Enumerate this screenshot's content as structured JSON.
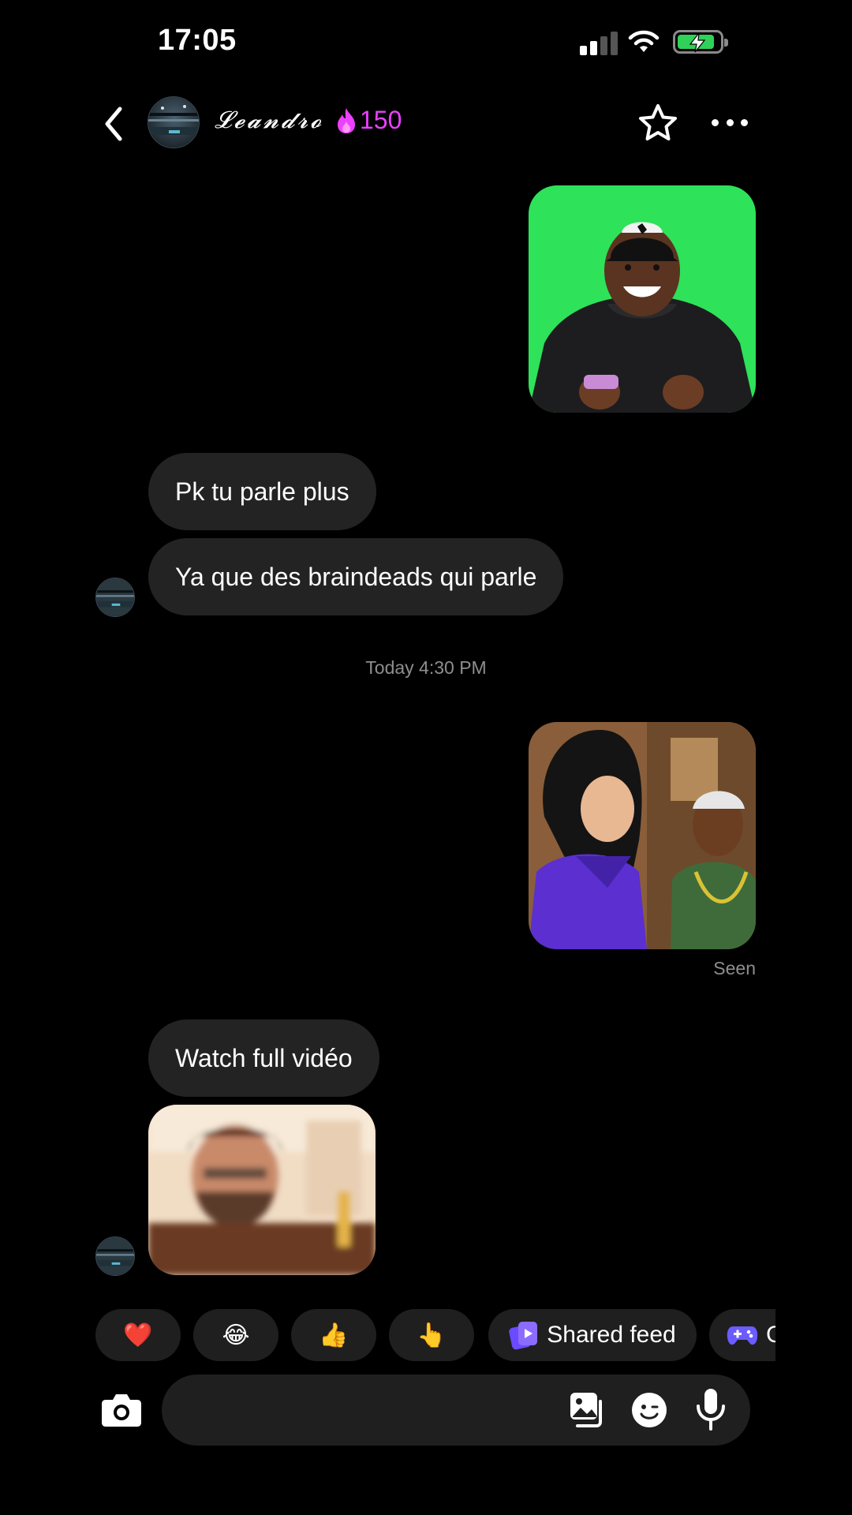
{
  "status_bar": {
    "time": "17:05",
    "signal_icon": "cellular-signal-icon",
    "wifi_icon": "wifi-icon",
    "battery_icon": "battery-charging-icon",
    "battery_color": "#30d158"
  },
  "header": {
    "back_icon": "chevron-left-icon",
    "contact_name": "𝓛𝓮𝓪𝓷𝓭𝓻𝓸",
    "streak_icon": "flame-icon",
    "streak_count": "150",
    "streak_color": "#ec40ff",
    "favorite_icon": "star-outline-icon",
    "more_icon": "more-horizontal-icon"
  },
  "messages": [
    {
      "type": "media",
      "from": "me",
      "description": "video thumbnail"
    },
    {
      "type": "text",
      "from": "contact",
      "text": "Pk tu parle plus"
    },
    {
      "type": "text",
      "from": "contact",
      "text": "Ya que des braindeads qui parle"
    },
    {
      "type": "timestamp",
      "text": "Today 4:30 PM"
    },
    {
      "type": "media",
      "from": "me"
    },
    {
      "type": "status",
      "text": "Seen"
    },
    {
      "type": "text",
      "from": "contact",
      "text": "Watch full vidéo"
    },
    {
      "type": "media",
      "from": "contact"
    }
  ],
  "quick_replies": [
    {
      "emoji": "❤️",
      "icon": "heart-icon"
    },
    {
      "emoji": "😂",
      "icon": "laughing-icon"
    },
    {
      "emoji": "👍",
      "icon": "thumbs-up-icon"
    },
    {
      "emoji": "👆",
      "icon": "pointing-up-icon"
    },
    {
      "label": "Shared feed",
      "icon": "shared-feed-icon"
    },
    {
      "label": "G",
      "icon": "game-controller-icon"
    }
  ],
  "composer": {
    "placeholder": "",
    "camera_icon": "camera-icon",
    "gallery_icon": "gallery-icon",
    "sticker_icon": "sticker-icon",
    "mic_icon": "microphone-icon"
  }
}
